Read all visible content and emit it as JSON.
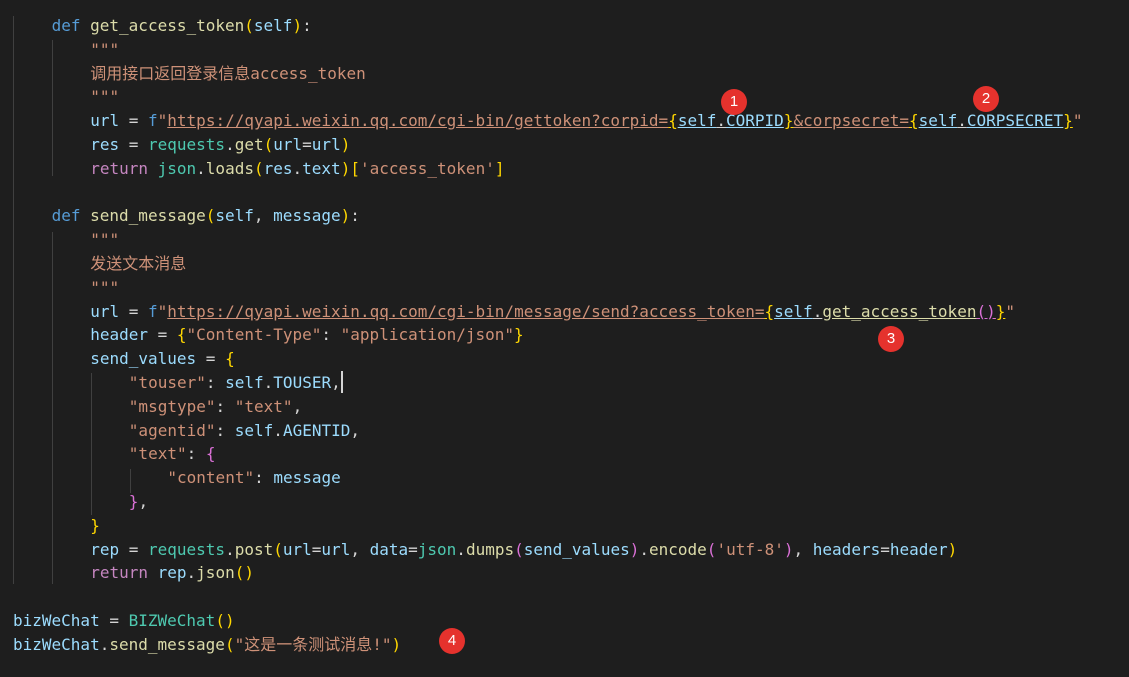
{
  "code_lines": [
    {
      "indent": 1,
      "tokens": [
        {
          "t": "def",
          "c": "kw"
        },
        {
          "t": " ",
          "c": "plain"
        },
        {
          "t": "get_access_token",
          "c": "fn"
        },
        {
          "t": "(",
          "c": "p1"
        },
        {
          "t": "self",
          "c": "var"
        },
        {
          "t": ")",
          "c": "p1"
        },
        {
          "t": ":",
          "c": "plain"
        }
      ]
    },
    {
      "indent": 2,
      "tokens": [
        {
          "t": "\"\"\"",
          "c": "str"
        }
      ]
    },
    {
      "indent": 2,
      "tokens": [
        {
          "t": "调用接口返回登录信息access_token",
          "c": "str"
        }
      ]
    },
    {
      "indent": 2,
      "tokens": [
        {
          "t": "\"\"\"",
          "c": "str"
        }
      ]
    },
    {
      "indent": 2,
      "tokens": [
        {
          "t": "url",
          "c": "var"
        },
        {
          "t": " = ",
          "c": "plain"
        },
        {
          "t": "f",
          "c": "kw"
        },
        {
          "t": "\"",
          "c": "str"
        },
        {
          "t": "https://qyapi.weixin.qq.com/cgi-bin/gettoken?corpid=",
          "c": "str url"
        },
        {
          "t": "{",
          "c": "p1 url"
        },
        {
          "t": "self",
          "c": "var url"
        },
        {
          "t": ".",
          "c": "plain url"
        },
        {
          "t": "CORPID",
          "c": "var url"
        },
        {
          "t": "}",
          "c": "p1 url"
        },
        {
          "t": "&corpsecret=",
          "c": "str url"
        },
        {
          "t": "{",
          "c": "p1 url"
        },
        {
          "t": "self",
          "c": "var url"
        },
        {
          "t": ".",
          "c": "plain url"
        },
        {
          "t": "CORPSECRET",
          "c": "var url"
        },
        {
          "t": "}",
          "c": "p1 url"
        },
        {
          "t": "\"",
          "c": "str"
        }
      ]
    },
    {
      "indent": 2,
      "tokens": [
        {
          "t": "res",
          "c": "var"
        },
        {
          "t": " = ",
          "c": "plain"
        },
        {
          "t": "requests",
          "c": "cls"
        },
        {
          "t": ".",
          "c": "plain"
        },
        {
          "t": "get",
          "c": "fn"
        },
        {
          "t": "(",
          "c": "p1"
        },
        {
          "t": "url",
          "c": "var"
        },
        {
          "t": "=",
          "c": "plain"
        },
        {
          "t": "url",
          "c": "var"
        },
        {
          "t": ")",
          "c": "p1"
        }
      ]
    },
    {
      "indent": 2,
      "tokens": [
        {
          "t": "return",
          "c": "ctl"
        },
        {
          "t": " ",
          "c": "plain"
        },
        {
          "t": "json",
          "c": "cls"
        },
        {
          "t": ".",
          "c": "plain"
        },
        {
          "t": "loads",
          "c": "fn"
        },
        {
          "t": "(",
          "c": "p1"
        },
        {
          "t": "res",
          "c": "var"
        },
        {
          "t": ".",
          "c": "plain"
        },
        {
          "t": "text",
          "c": "var"
        },
        {
          "t": ")",
          "c": "p1"
        },
        {
          "t": "[",
          "c": "p1"
        },
        {
          "t": "'access_token'",
          "c": "str"
        },
        {
          "t": "]",
          "c": "p1"
        }
      ]
    },
    {
      "indent": 0,
      "tokens": []
    },
    {
      "indent": 1,
      "tokens": [
        {
          "t": "def",
          "c": "kw"
        },
        {
          "t": " ",
          "c": "plain"
        },
        {
          "t": "send_message",
          "c": "fn"
        },
        {
          "t": "(",
          "c": "p1"
        },
        {
          "t": "self",
          "c": "var"
        },
        {
          "t": ", ",
          "c": "plain"
        },
        {
          "t": "message",
          "c": "var"
        },
        {
          "t": ")",
          "c": "p1"
        },
        {
          "t": ":",
          "c": "plain"
        }
      ]
    },
    {
      "indent": 2,
      "tokens": [
        {
          "t": "\"\"\"",
          "c": "str"
        }
      ]
    },
    {
      "indent": 2,
      "tokens": [
        {
          "t": "发送文本消息",
          "c": "str"
        }
      ]
    },
    {
      "indent": 2,
      "tokens": [
        {
          "t": "\"\"\"",
          "c": "str"
        }
      ]
    },
    {
      "indent": 2,
      "tokens": [
        {
          "t": "url",
          "c": "var"
        },
        {
          "t": " = ",
          "c": "plain"
        },
        {
          "t": "f",
          "c": "kw"
        },
        {
          "t": "\"",
          "c": "str"
        },
        {
          "t": "https://qyapi.weixin.qq.com/cgi-bin/message/send?access_token=",
          "c": "str url"
        },
        {
          "t": "{",
          "c": "p1 url"
        },
        {
          "t": "self",
          "c": "var url"
        },
        {
          "t": ".",
          "c": "plain url"
        },
        {
          "t": "get_access_token",
          "c": "fn url"
        },
        {
          "t": "(",
          "c": "p2 url"
        },
        {
          "t": ")",
          "c": "p2 url"
        },
        {
          "t": "}",
          "c": "p1 url"
        },
        {
          "t": "\"",
          "c": "str"
        }
      ]
    },
    {
      "indent": 2,
      "tokens": [
        {
          "t": "header",
          "c": "var"
        },
        {
          "t": " = ",
          "c": "plain"
        },
        {
          "t": "{",
          "c": "p1"
        },
        {
          "t": "\"Content-Type\"",
          "c": "str"
        },
        {
          "t": ": ",
          "c": "plain"
        },
        {
          "t": "\"application/json\"",
          "c": "str"
        },
        {
          "t": "}",
          "c": "p1"
        }
      ]
    },
    {
      "indent": 2,
      "tokens": [
        {
          "t": "send_values",
          "c": "var"
        },
        {
          "t": " = ",
          "c": "plain"
        },
        {
          "t": "{",
          "c": "p1"
        }
      ]
    },
    {
      "indent": 3,
      "tokens": [
        {
          "t": "\"touser\"",
          "c": "str"
        },
        {
          "t": ": ",
          "c": "plain"
        },
        {
          "t": "self",
          "c": "var"
        },
        {
          "t": ".",
          "c": "plain"
        },
        {
          "t": "TOUSER",
          "c": "var"
        },
        {
          "t": ",",
          "c": "plain"
        }
      ]
    },
    {
      "indent": 3,
      "tokens": [
        {
          "t": "\"msgtype\"",
          "c": "str"
        },
        {
          "t": ": ",
          "c": "plain"
        },
        {
          "t": "\"text\"",
          "c": "str"
        },
        {
          "t": ",",
          "c": "plain"
        }
      ]
    },
    {
      "indent": 3,
      "tokens": [
        {
          "t": "\"agentid\"",
          "c": "str"
        },
        {
          "t": ": ",
          "c": "plain"
        },
        {
          "t": "self",
          "c": "var"
        },
        {
          "t": ".",
          "c": "plain"
        },
        {
          "t": "AGENTID",
          "c": "var"
        },
        {
          "t": ",",
          "c": "plain"
        }
      ]
    },
    {
      "indent": 3,
      "tokens": [
        {
          "t": "\"text\"",
          "c": "str"
        },
        {
          "t": ": ",
          "c": "plain"
        },
        {
          "t": "{",
          "c": "p2"
        }
      ]
    },
    {
      "indent": 4,
      "tokens": [
        {
          "t": "\"content\"",
          "c": "str"
        },
        {
          "t": ": ",
          "c": "plain"
        },
        {
          "t": "message",
          "c": "var"
        }
      ]
    },
    {
      "indent": 3,
      "tokens": [
        {
          "t": "}",
          "c": "p2"
        },
        {
          "t": ",",
          "c": "plain"
        }
      ]
    },
    {
      "indent": 2,
      "tokens": [
        {
          "t": "}",
          "c": "p1"
        }
      ]
    },
    {
      "indent": 2,
      "tokens": [
        {
          "t": "rep",
          "c": "var"
        },
        {
          "t": " = ",
          "c": "plain"
        },
        {
          "t": "requests",
          "c": "cls"
        },
        {
          "t": ".",
          "c": "plain"
        },
        {
          "t": "post",
          "c": "fn"
        },
        {
          "t": "(",
          "c": "p1"
        },
        {
          "t": "url",
          "c": "var"
        },
        {
          "t": "=",
          "c": "plain"
        },
        {
          "t": "url",
          "c": "var"
        },
        {
          "t": ", ",
          "c": "plain"
        },
        {
          "t": "data",
          "c": "var"
        },
        {
          "t": "=",
          "c": "plain"
        },
        {
          "t": "json",
          "c": "cls"
        },
        {
          "t": ".",
          "c": "plain"
        },
        {
          "t": "dumps",
          "c": "fn"
        },
        {
          "t": "(",
          "c": "p2"
        },
        {
          "t": "send_values",
          "c": "var"
        },
        {
          "t": ")",
          "c": "p2"
        },
        {
          "t": ".",
          "c": "plain"
        },
        {
          "t": "encode",
          "c": "fn"
        },
        {
          "t": "(",
          "c": "p2"
        },
        {
          "t": "'utf-8'",
          "c": "str"
        },
        {
          "t": ")",
          "c": "p2"
        },
        {
          "t": ", ",
          "c": "plain"
        },
        {
          "t": "headers",
          "c": "var"
        },
        {
          "t": "=",
          "c": "plain"
        },
        {
          "t": "header",
          "c": "var"
        },
        {
          "t": ")",
          "c": "p1"
        }
      ]
    },
    {
      "indent": 2,
      "tokens": [
        {
          "t": "return",
          "c": "ctl"
        },
        {
          "t": " ",
          "c": "plain"
        },
        {
          "t": "rep",
          "c": "var"
        },
        {
          "t": ".",
          "c": "plain"
        },
        {
          "t": "json",
          "c": "fn"
        },
        {
          "t": "(",
          "c": "p1"
        },
        {
          "t": ")",
          "c": "p1"
        }
      ]
    },
    {
      "indent": 0,
      "tokens": []
    },
    {
      "indent": 0,
      "tokens": [
        {
          "t": "bizWeChat",
          "c": "var"
        },
        {
          "t": " = ",
          "c": "plain"
        },
        {
          "t": "BIZWeChat",
          "c": "cls"
        },
        {
          "t": "(",
          "c": "p1"
        },
        {
          "t": ")",
          "c": "p1"
        }
      ]
    },
    {
      "indent": 0,
      "tokens": [
        {
          "t": "bizWeChat",
          "c": "var"
        },
        {
          "t": ".",
          "c": "plain"
        },
        {
          "t": "send_message",
          "c": "fn"
        },
        {
          "t": "(",
          "c": "p1"
        },
        {
          "t": "\"这是一条测试消息!\"",
          "c": "str"
        },
        {
          "t": ")",
          "c": "p1"
        }
      ]
    }
  ],
  "annotations": [
    {
      "label": "1"
    },
    {
      "label": "2"
    },
    {
      "label": "3"
    },
    {
      "label": "4"
    }
  ]
}
